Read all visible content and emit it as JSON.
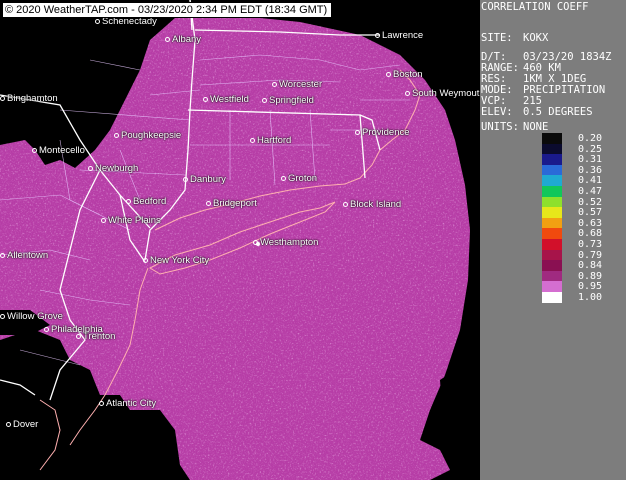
{
  "copyright": "© 2020 WeatherTAP.com - 03/23/2020  2:34 PM EDT (18:34 GMT)",
  "panel": {
    "product": "CORRELATION COEFF",
    "site_label": "SITE:",
    "site_value": "KOKX",
    "dt_label": "D/T:",
    "dt_value": "03/23/20 1834Z",
    "range_label": "RANGE:",
    "range_value": "460 KM",
    "res_label": "RES:",
    "res_value": "1KM X 1DEG",
    "mode_label": "MODE:",
    "mode_value": "PRECIPITATION",
    "vcp_label": "VCP:",
    "vcp_value": "215",
    "elev_label": "ELEV:",
    "elev_value": "0.5 DEGREES",
    "units_label": "UNITS:",
    "units_value": "NONE"
  },
  "legend": [
    {
      "value": "0.20",
      "color": "#0a0a0a"
    },
    {
      "value": "0.25",
      "color": "#0b0b2e"
    },
    {
      "value": "0.31",
      "color": "#1a1a8c"
    },
    {
      "value": "0.36",
      "color": "#2a6ad8"
    },
    {
      "value": "0.41",
      "color": "#1faad2"
    },
    {
      "value": "0.47",
      "color": "#11c75a"
    },
    {
      "value": "0.52",
      "color": "#8ee02c"
    },
    {
      "value": "0.57",
      "color": "#e7e71a"
    },
    {
      "value": "0.63",
      "color": "#f2a012"
    },
    {
      "value": "0.68",
      "color": "#f14a0e"
    },
    {
      "value": "0.73",
      "color": "#d2102a"
    },
    {
      "value": "0.79",
      "color": "#a7144a"
    },
    {
      "value": "0.84",
      "color": "#8a1052"
    },
    {
      "value": "0.89",
      "color": "#a02a80"
    },
    {
      "value": "0.95",
      "color": "#d46ed0"
    },
    {
      "value": "1.00",
      "color": "#ffffff"
    }
  ],
  "colors": {
    "echo": "#b63ca6",
    "echo_dark": "#8c1f72",
    "echo_light": "#d472c8",
    "background": "#000000",
    "state_border": "#ffffff",
    "county_border": "#e8c8ff",
    "coast": "#ffb0b0",
    "panel": "#7d7d7d"
  },
  "cities": [
    {
      "name": "Schenectady"
    },
    {
      "name": "Albany"
    },
    {
      "name": "Lawrence"
    },
    {
      "name": "Boston"
    },
    {
      "name": "Worcester"
    },
    {
      "name": "Westfield"
    },
    {
      "name": "Springfield"
    },
    {
      "name": "South Weymouth"
    },
    {
      "name": "Binghamton"
    },
    {
      "name": "Poughkeepsie"
    },
    {
      "name": "Hartford"
    },
    {
      "name": "Providence"
    },
    {
      "name": "Montecello"
    },
    {
      "name": "Newburgh"
    },
    {
      "name": "Danbury"
    },
    {
      "name": "Groton"
    },
    {
      "name": "Bedford"
    },
    {
      "name": "Bridgeport"
    },
    {
      "name": "Block Island"
    },
    {
      "name": "White Plains"
    },
    {
      "name": "Westhampton"
    },
    {
      "name": "Allentown"
    },
    {
      "name": "New York City"
    },
    {
      "name": "Willow Grove"
    },
    {
      "name": "Trenton"
    },
    {
      "name": "Philadelphia"
    },
    {
      "name": "Atlantic City"
    },
    {
      "name": "Dover"
    }
  ]
}
